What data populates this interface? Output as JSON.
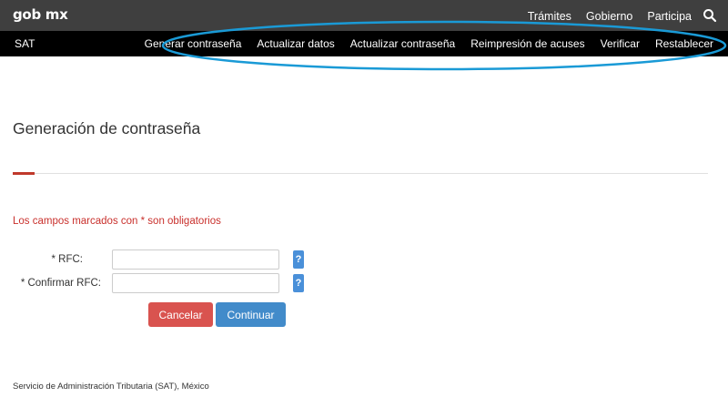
{
  "header": {
    "logo": "gob mx",
    "links": [
      "Trámites",
      "Gobierno",
      "Participa"
    ],
    "search_icon": "search-icon"
  },
  "nav": {
    "brand": "SAT",
    "items": [
      "Generar contraseña",
      "Actualizar datos",
      "Actualizar contraseña",
      "Reimpresión de acuses",
      "Verificar",
      "Restablecer"
    ]
  },
  "page": {
    "title": "Generación de contraseña",
    "required_note": "Los campos marcados con * son obligatorios"
  },
  "form": {
    "rfc_label": "* RFC:",
    "rfc_value": "",
    "confirm_label": "* Confirmar RFC:",
    "confirm_value": "",
    "help_label": "?",
    "cancel_label": "Cancelar",
    "continue_label": "Continuar"
  },
  "footer": {
    "text": "Servicio de Administración Tributaria (SAT), México"
  },
  "colors": {
    "topbar": "#3f3f3f",
    "navbar": "#000000",
    "accent_red": "#c0392b",
    "required_text": "#c9302c",
    "cancel": "#d9534f",
    "continue": "#428bca",
    "help": "#4a90d9",
    "annotation_ellipse": "#1a9ad6"
  }
}
